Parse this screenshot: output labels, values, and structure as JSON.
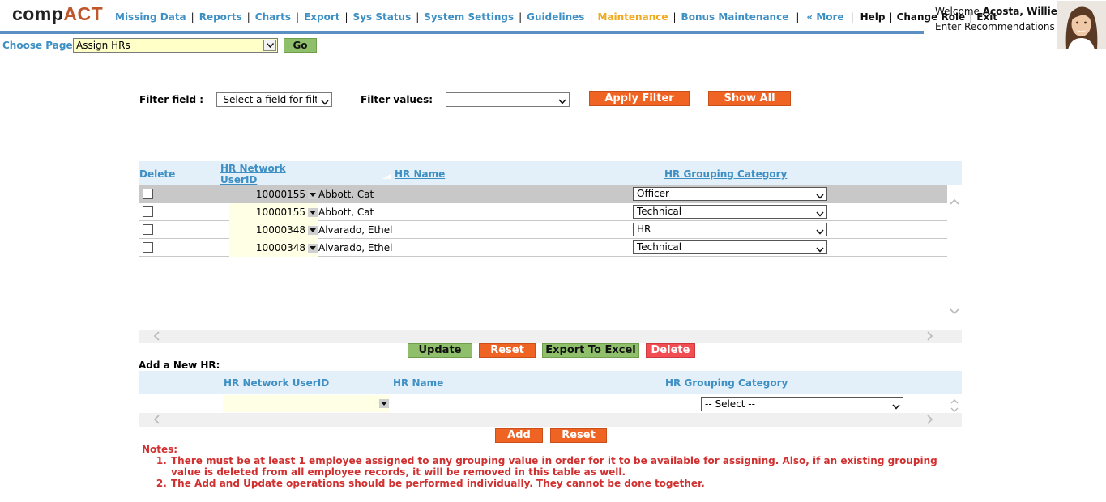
{
  "logo": {
    "prefix": "comp",
    "suffix": "ACT"
  },
  "nav": {
    "items": [
      "Missing Data",
      "Reports",
      "Charts",
      "Export",
      "Sys Status",
      "System Settings",
      "Guidelines",
      "Maintenance",
      "Bonus Maintenance",
      "« More",
      "Help",
      "Change Role",
      "Exit"
    ],
    "active": "Maintenance"
  },
  "user": {
    "welcome_prefix": "Welcome",
    "name": "Acosta, Willie",
    "role_text": "Enter Recommendations"
  },
  "choose_page": {
    "label": "Choose Page:",
    "selected": "Assign HRs",
    "go_label": "Go"
  },
  "filter": {
    "field_label": "Filter field :",
    "field_value": "-Select a field for filte",
    "values_label": "Filter values:",
    "values_value": "",
    "apply_label": "Apply Filter",
    "show_all_label": "Show All"
  },
  "grid": {
    "columns": {
      "delete": "Delete",
      "id_line1": "HR Network",
      "id_line2": "UserID",
      "name": "HR Name",
      "category": "HR Grouping Category"
    },
    "rows": [
      {
        "id": "10000155",
        "name": "Abbott, Cat",
        "category": "Officer",
        "selected": true
      },
      {
        "id": "10000155",
        "name": "Abbott, Cat",
        "category": "Technical",
        "selected": false
      },
      {
        "id": "10000348",
        "name": "Alvarado, Ethel",
        "category": "HR",
        "selected": false
      },
      {
        "id": "10000348",
        "name": "Alvarado, Ethel",
        "category": "Technical",
        "selected": false
      }
    ]
  },
  "actions": {
    "update": "Update",
    "reset": "Reset",
    "export": "Export To Excel",
    "delete": "Delete"
  },
  "add_new": {
    "label": "Add a New HR:",
    "columns": {
      "id": "HR Network UserID",
      "name": "HR Name",
      "category": "HR Grouping Category"
    },
    "category_placeholder": "-- Select --",
    "add_label": "Add",
    "reset_label": "Reset"
  },
  "notes": {
    "title": "Notes:",
    "items": [
      "There must be at least 1 employee assigned to any grouping value in order for it to be available for assigning. Also, if an existing grouping value is deleted from all employee records, it will be removed in this table as well.",
      "The Add and Update operations should be performed individually. They cannot be done together."
    ]
  },
  "colors": {
    "accent_blue": "#3d8fc4",
    "active_orange": "#f0a81d",
    "button_orange": "#ef6423",
    "button_green": "#8fbf6a",
    "button_red": "#f24d52",
    "notes_red": "#d13030"
  },
  "icons": [
    "dropdown-arrow-icon",
    "sort-arrow-icon",
    "scroll-up-icon",
    "scroll-down-icon",
    "scroll-left-icon",
    "scroll-right-icon",
    "user-avatar"
  ]
}
